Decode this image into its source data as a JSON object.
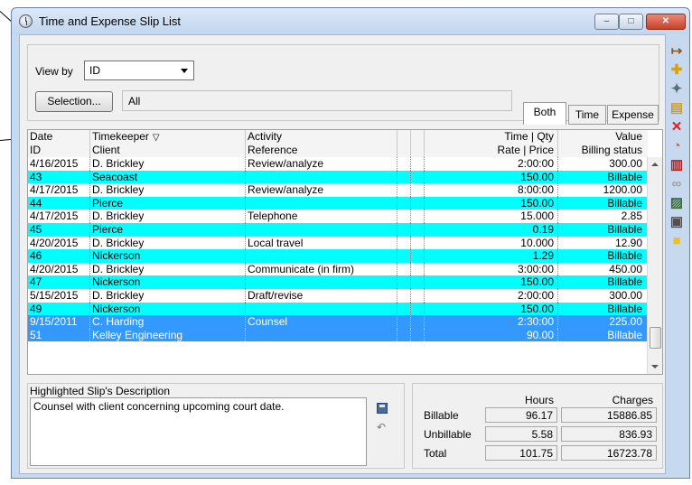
{
  "window": {
    "title": "Time and Expense Slip List",
    "min_glyph": "–",
    "max_glyph": "□",
    "close_glyph": "✕"
  },
  "filter": {
    "viewby_label": "View by",
    "viewby_value": "ID",
    "selection_button": "Selection...",
    "selection_value": "All"
  },
  "tabs": {
    "both": "Both",
    "time": "Time",
    "expense": "Expense",
    "active": "Both"
  },
  "grid": {
    "header1": {
      "c1": "Date",
      "c2": "Timekeeper",
      "c3": "Activity",
      "c6": "Time | Qty",
      "c7": "Value"
    },
    "header2": {
      "c1": "ID",
      "c2": "Client",
      "c3": "Reference",
      "c6": "Rate | Price",
      "c7": "Billing status"
    },
    "sort_glyph": "▽",
    "rows": [
      {
        "style": "white",
        "c1": "4/16/2015",
        "c2": "D. Brickley",
        "c3": "Review/analyze",
        "c6": "2:00:00",
        "c7": "300.00"
      },
      {
        "style": "cyan",
        "c1": "43",
        "c2": "Seacoast",
        "c3": "",
        "c6": "150.00",
        "c7": "Billable"
      },
      {
        "style": "white",
        "c1": "4/17/2015",
        "c2": "D. Brickley",
        "c3": "Review/analyze",
        "c6": "8:00:00",
        "c7": "1200.00"
      },
      {
        "style": "cyan",
        "c1": "44",
        "c2": "Pierce",
        "c3": "",
        "c6": "150.00",
        "c7": "Billable"
      },
      {
        "style": "white",
        "c1": "4/17/2015",
        "c2": "D. Brickley",
        "c3": "Telephone",
        "c6": "15.000",
        "c7": "2.85"
      },
      {
        "style": "cyan",
        "c1": "45",
        "c2": "Pierce",
        "c3": "",
        "c6": "0.19",
        "c7": "Billable"
      },
      {
        "style": "white",
        "c1": "4/20/2015",
        "c2": "D. Brickley",
        "c3": "Local travel",
        "c6": "10.000",
        "c7": "12.90"
      },
      {
        "style": "cyan",
        "c1": "46",
        "c2": "Nickerson",
        "c3": "",
        "c6": "1.29",
        "c7": "Billable"
      },
      {
        "style": "white",
        "c1": "4/20/2015",
        "c2": "D. Brickley",
        "c3": "Communicate (in firm)",
        "c6": "3:00:00",
        "c7": "450.00"
      },
      {
        "style": "cyan",
        "c1": "47",
        "c2": "Nickerson",
        "c3": "",
        "c6": "150.00",
        "c7": "Billable"
      },
      {
        "style": "white",
        "c1": "5/15/2015",
        "c2": "D. Brickley",
        "c3": "Draft/revise",
        "c6": "2:00:00",
        "c7": "300.00"
      },
      {
        "style": "cyan",
        "c1": "49",
        "c2": "Nickerson",
        "c3": "",
        "c6": "150.00",
        "c7": "Billable"
      },
      {
        "style": "sel",
        "c1": "9/15/2011",
        "c2": "C. Harding",
        "c3": "Counsel",
        "c6": "2:30:00",
        "c7": "225.00"
      },
      {
        "style": "sel",
        "c1": "51",
        "c2": "Kelley Engineering",
        "c3": "",
        "c6": "90.00",
        "c7": "Billable"
      }
    ]
  },
  "description": {
    "label": "Highlighted Slip's Description",
    "text": "Counsel with client concerning upcoming court date.",
    "undo_glyph": "↶"
  },
  "totals": {
    "hours_header": "Hours",
    "charges_header": "Charges",
    "rows": [
      {
        "label": "Billable",
        "hours": "96.17",
        "charges": "15886.85"
      },
      {
        "label": "Unbillable",
        "hours": "5.58",
        "charges": "836.93"
      },
      {
        "label": "Total",
        "hours": "101.75",
        "charges": "16723.78"
      }
    ]
  },
  "toolbar": [
    {
      "name": "open-slip-icon",
      "glyph": "↦",
      "color": "#8a5a2a"
    },
    {
      "name": "add-slip-icon",
      "glyph": "✚",
      "color": "#e0a000"
    },
    {
      "name": "duplicate-slip-icon",
      "glyph": "✦",
      "color": "#5a6a7a"
    },
    {
      "name": "open-folder-icon",
      "glyph": "▤",
      "color": "#d29a2a"
    },
    {
      "name": "delete-icon",
      "glyph": "✕",
      "color": "#e02020"
    },
    {
      "name": "timer-icon",
      "glyph": "◔",
      "color": "#e06010"
    },
    {
      "name": "reference-book-icon",
      "glyph": "▥",
      "color": "#b02020"
    },
    {
      "name": "link-icon",
      "glyph": "∞",
      "color": "#a0a0a0"
    },
    {
      "name": "report-icon",
      "glyph": "▨",
      "color": "#3a6a3a"
    },
    {
      "name": "print-icon",
      "glyph": "▣",
      "color": "#505050"
    },
    {
      "name": "note-icon",
      "glyph": "■",
      "color": "#f0c020"
    }
  ]
}
